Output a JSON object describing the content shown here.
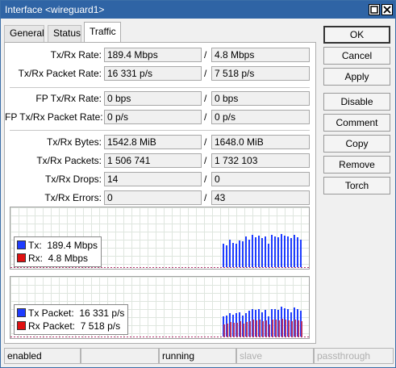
{
  "window": {
    "title": "Interface <wireguard1>"
  },
  "tabs": [
    {
      "label": "General"
    },
    {
      "label": "Status"
    },
    {
      "label": "Traffic",
      "active": true
    }
  ],
  "fields": {
    "tx_rx_rate": {
      "label": "Tx/Rx Rate:",
      "tx": "189.4 Mbps",
      "rx": "4.8 Mbps"
    },
    "tx_rx_packet_rate": {
      "label": "Tx/Rx Packet Rate:",
      "tx": "16 331 p/s",
      "rx": "7 518 p/s"
    },
    "fp_tx_rx_rate": {
      "label": "FP Tx/Rx Rate:",
      "tx": "0 bps",
      "rx": "0 bps"
    },
    "fp_tx_rx_packet_rate": {
      "label": "FP Tx/Rx Packet Rate:",
      "tx": "0 p/s",
      "rx": "0 p/s"
    },
    "tx_rx_bytes": {
      "label": "Tx/Rx Bytes:",
      "tx": "1542.8 MiB",
      "rx": "1648.0 MiB"
    },
    "tx_rx_packets": {
      "label": "Tx/Rx Packets:",
      "tx": "1 506 741",
      "rx": "1 732 103"
    },
    "tx_rx_drops": {
      "label": "Tx/Rx Drops:",
      "tx": "14",
      "rx": "0"
    },
    "tx_rx_errors": {
      "label": "Tx/Rx Errors:",
      "tx": "0",
      "rx": "43"
    },
    "separator": "/"
  },
  "graphs": {
    "rate": {
      "legend": [
        {
          "label": "Tx:",
          "value": "189.4 Mbps",
          "color": "#1e3cff"
        },
        {
          "label": "Rx:",
          "value": "4.8 Mbps",
          "color": "#e01010"
        }
      ],
      "tx_levels": [
        0.7,
        0.65,
        0.8,
        0.72,
        0.68,
        0.78,
        0.75,
        0.9,
        0.82,
        0.95,
        0.88,
        0.92,
        0.85,
        0.9,
        0.7,
        0.95,
        0.9,
        0.88,
        0.98,
        0.92,
        0.9,
        0.85,
        0.95,
        0.88,
        0.82
      ]
    },
    "packets": {
      "legend": [
        {
          "label": "Tx Packet:",
          "value": "16 331 p/s",
          "color": "#1e3cff"
        },
        {
          "label": "Rx Packet:",
          "value": "7 518 p/s",
          "color": "#e01010"
        }
      ],
      "tx_levels": [
        0.6,
        0.62,
        0.7,
        0.65,
        0.68,
        0.72,
        0.62,
        0.7,
        0.75,
        0.82,
        0.78,
        0.8,
        0.72,
        0.78,
        0.6,
        0.8,
        0.82,
        0.78,
        0.88,
        0.84,
        0.8,
        0.72,
        0.85,
        0.8,
        0.75
      ],
      "rx_levels": [
        0.35,
        0.38,
        0.42,
        0.4,
        0.4,
        0.45,
        0.38,
        0.42,
        0.45,
        0.5,
        0.48,
        0.5,
        0.45,
        0.48,
        0.35,
        0.5,
        0.5,
        0.48,
        0.52,
        0.5,
        0.48,
        0.45,
        0.5,
        0.48,
        0.45
      ]
    }
  },
  "buttons": [
    {
      "label": "OK",
      "default": true
    },
    {
      "label": "Cancel"
    },
    {
      "label": "Apply"
    },
    {
      "label": "Disable"
    },
    {
      "label": "Comment"
    },
    {
      "label": "Copy"
    },
    {
      "label": "Remove"
    },
    {
      "label": "Torch"
    }
  ],
  "status_bar": [
    {
      "text": "enabled",
      "dim": false
    },
    {
      "text": "",
      "dim": false
    },
    {
      "text": "running",
      "dim": false
    },
    {
      "text": "slave",
      "dim": true
    },
    {
      "text": "passthrough",
      "dim": true
    }
  ],
  "colors": {
    "titlebar": "#2f64a5",
    "tx": "#1e3cff",
    "rx": "#e01010",
    "rx_packet": "#b0306a"
  }
}
